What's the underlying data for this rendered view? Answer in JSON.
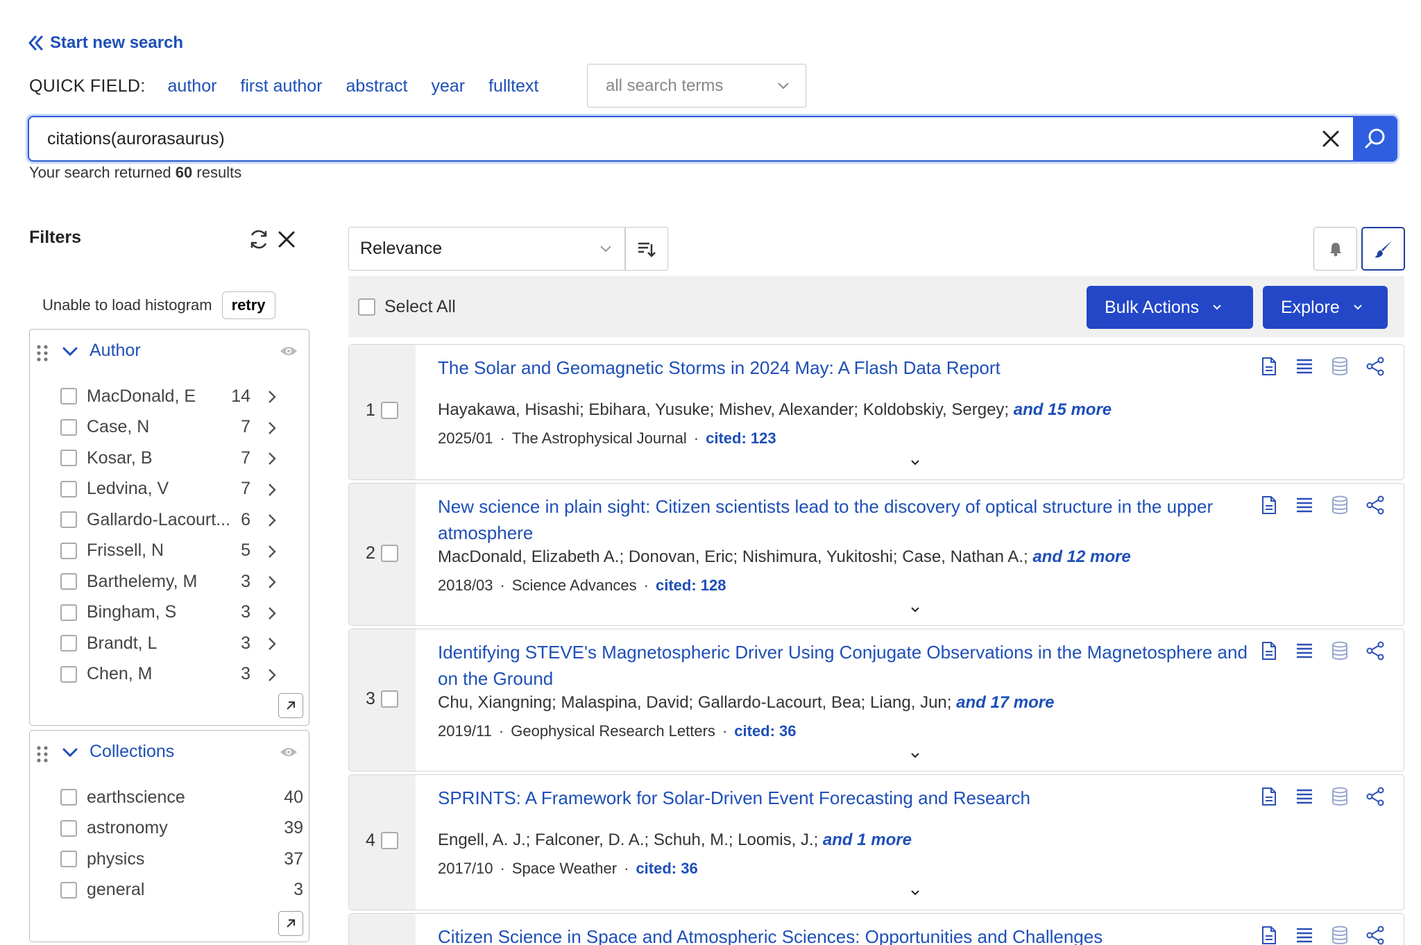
{
  "header": {
    "start_new": "Start new search",
    "quick_field_label": "QUICK FIELD:",
    "quick_fields": [
      "author",
      "first author",
      "abstract",
      "year",
      "fulltext"
    ],
    "field_select": "all search terms",
    "query": "citations(aurorasaurus)",
    "results_prefix": "Your search returned",
    "results_count": "60",
    "results_suffix": "results"
  },
  "filters": {
    "title": "Filters",
    "histogram_msg": "Unable to load histogram",
    "retry": "retry",
    "author": {
      "title": "Author",
      "items": [
        {
          "name": "MacDonald, E",
          "count": "14"
        },
        {
          "name": "Case, N",
          "count": "7"
        },
        {
          "name": "Kosar, B",
          "count": "7"
        },
        {
          "name": "Ledvina, V",
          "count": "7"
        },
        {
          "name": "Gallardo-Lacourt...",
          "count": "6"
        },
        {
          "name": "Frissell, N",
          "count": "5"
        },
        {
          "name": "Barthelemy, M",
          "count": "3"
        },
        {
          "name": "Bingham, S",
          "count": "3"
        },
        {
          "name": "Brandt, L",
          "count": "3"
        },
        {
          "name": "Chen, M",
          "count": "3"
        }
      ]
    },
    "collections": {
      "title": "Collections",
      "items": [
        {
          "name": "earthscience",
          "count": "40"
        },
        {
          "name": "astronomy",
          "count": "39"
        },
        {
          "name": "physics",
          "count": "37"
        },
        {
          "name": "general",
          "count": "3"
        }
      ]
    }
  },
  "toolbar": {
    "sort": "Relevance",
    "select_all": "Select All",
    "bulk_actions": "Bulk Actions",
    "explore": "Explore"
  },
  "results": [
    {
      "index": "1",
      "title": "The Solar and Geomagnetic Storms in 2024 May: A Flash Data Report",
      "authors": "Hayakawa, Hisashi; Ebihara, Yusuke; Mishev, Alexander; Koldobskiy, Sergey;",
      "more": "and 15 more",
      "date": "2025/01",
      "journal": "The Astrophysical Journal",
      "cited": "cited: 123"
    },
    {
      "index": "2",
      "title": "New science in plain sight: Citizen scientists lead to the discovery of optical structure in the upper atmosphere",
      "authors": "MacDonald, Elizabeth A.; Donovan, Eric; Nishimura, Yukitoshi; Case, Nathan A.;",
      "more": "and 12 more",
      "date": "2018/03",
      "journal": "Science Advances",
      "cited": "cited: 128"
    },
    {
      "index": "3",
      "title": "Identifying STEVE's Magnetospheric Driver Using Conjugate Observations in the Magnetosphere and on the Ground",
      "authors": "Chu, Xiangning; Malaspina, David; Gallardo-Lacourt, Bea; Liang, Jun;",
      "more": "and 17 more",
      "date": "2019/11",
      "journal": "Geophysical Research Letters",
      "cited": "cited: 36"
    },
    {
      "index": "4",
      "title": "SPRINTS: A Framework for Solar-Driven Event Forecasting and Research",
      "authors": "Engell, A. J.; Falconer, D. A.; Schuh, M.; Loomis, J.;",
      "more": "and 1 more",
      "date": "2017/10",
      "journal": "Space Weather",
      "cited": "cited: 36"
    },
    {
      "index": "",
      "title": "Citizen Science in Space and Atmospheric Sciences: Opportunities and Challenges"
    }
  ],
  "icons": {
    "start_new": "double-chevron-left-icon",
    "clear": "close-icon",
    "search": "search-icon",
    "refresh": "refresh-icon",
    "filters_close": "close-icon",
    "drag": "drag-handle-icon",
    "eye": "eye-icon",
    "row_arrow": "chevron-right-icon",
    "expand": "arrow-up-right-icon",
    "sort_direction": "sort-direction-icon",
    "notify": "bell-icon",
    "customize": "brush-icon",
    "abstract": "document-icon",
    "references": "list-icon",
    "data": "database-icon",
    "share": "share-icon"
  },
  "colors": {
    "link": "#1e4fb8",
    "primary_button": "#2347c7",
    "search_button": "#2f5fe0"
  }
}
